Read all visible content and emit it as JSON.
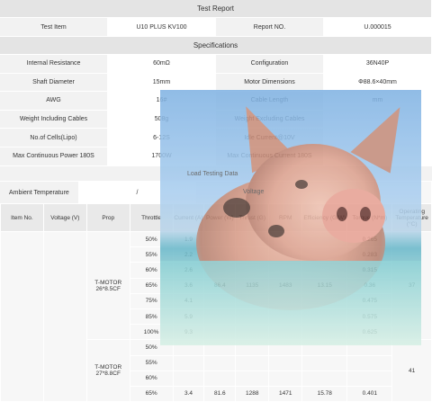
{
  "report": {
    "title": "Test Report",
    "test_item_label": "Test Item",
    "test_item_value": "U10 PLUS KV100",
    "report_no_label": "Report NO.",
    "report_no_value": "U.000015"
  },
  "specifications": {
    "title": "Specifications",
    "rows": [
      {
        "l1": "Internal Resistance",
        "v1": "60mΩ",
        "l2": "Configuration",
        "v2": "36N40P"
      },
      {
        "l1": "Shaft Diameter",
        "v1": "15mm",
        "l2": "Motor Dimensions",
        "v2": "Φ88.6×40mm"
      },
      {
        "l1": "AWG",
        "v1": "16#",
        "l2": "Cable Length",
        "v2": "mm"
      },
      {
        "l1": "Weight Including Cables",
        "v1": "508g",
        "l2": "Weight Excluding Cables",
        "v2": ""
      },
      {
        "l1": "No.of Cells(Lipo)",
        "v1": "6-12S",
        "l2": "Idle Current@10V",
        "v2": ""
      },
      {
        "l1": "Max Continuous Power 180S",
        "v1": "1700W",
        "l2": "Max Continuous Current 180S",
        "v2": ""
      }
    ],
    "load_testing_label": "Load Testing Data"
  },
  "ambient": {
    "label": "Ambient Temperature",
    "value": "/"
  },
  "perf_table": {
    "headers": [
      "Item No.",
      "Voltage (V)",
      "Prop",
      "Throttle",
      "Current (A)",
      "Power (W)",
      "Thrust (G)",
      "RPM",
      "Efficiency (G/W)",
      "Torque (N*m)",
      "Operating Temperature (°C)"
    ],
    "overlay_voltage_label": "Voltage",
    "group1_prop": "T-MOTOR 26*8.5CF",
    "group2_prop": "T-MOTOR 27*8.8CF",
    "group1_temp": "37",
    "group2_temp": "41",
    "rows": [
      {
        "t": "50%",
        "c": "1.9",
        "p": "",
        "th": "",
        "r": "",
        "e": "",
        "q": "0.265"
      },
      {
        "t": "55%",
        "c": "2.2",
        "p": "",
        "th": "",
        "r": "",
        "e": "",
        "q": "0.283"
      },
      {
        "t": "60%",
        "c": "2.6",
        "p": "",
        "th": "",
        "r": "",
        "e": "",
        "q": "0.315"
      },
      {
        "t": "65%",
        "c": "3.6",
        "p": "86.4",
        "th": "1135",
        "r": "1483",
        "e": "13.15",
        "q": "0.36"
      },
      {
        "t": "75%",
        "c": "4.1",
        "p": "",
        "th": "",
        "r": "",
        "e": "",
        "q": "0.475"
      },
      {
        "t": "85%",
        "c": "5.9",
        "p": "",
        "th": "",
        "r": "",
        "e": "",
        "q": "0.575"
      },
      {
        "t": "100%",
        "c": "9.3",
        "p": "",
        "th": "",
        "r": "",
        "e": "",
        "q": "0.625"
      },
      {
        "t": "50%",
        "c": "",
        "p": "",
        "th": "",
        "r": "",
        "e": "",
        "q": ""
      },
      {
        "t": "55%",
        "c": "",
        "p": "",
        "th": "",
        "r": "",
        "e": "",
        "q": ""
      },
      {
        "t": "60%",
        "c": "",
        "p": "",
        "th": "",
        "r": "",
        "e": "",
        "q": ""
      },
      {
        "t": "65%",
        "c": "3.4",
        "p": "81.6",
        "th": "1288",
        "r": "1471",
        "e": "15.78",
        "q": "0.401"
      }
    ]
  }
}
